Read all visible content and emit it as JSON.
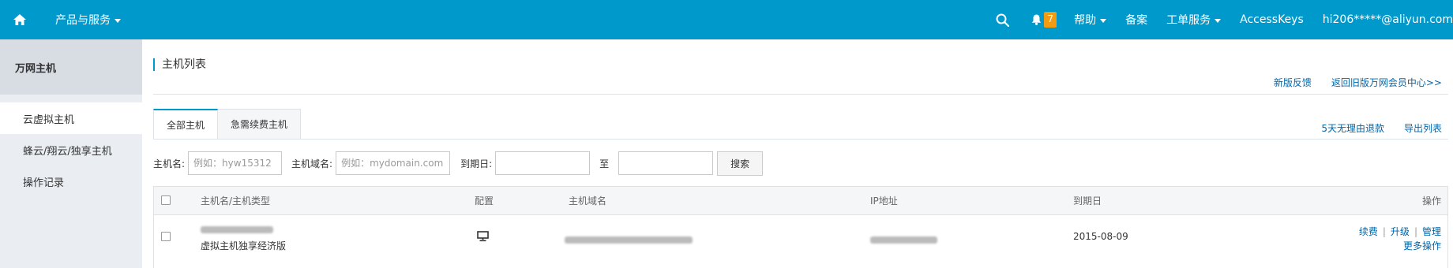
{
  "topbar": {
    "home_icon": "home-icon",
    "products_label": "产品与服务",
    "search_icon": "search-icon",
    "bell_icon": "bell-icon",
    "notification_count": "7",
    "help_label": "帮助",
    "beian_label": "备案",
    "ticket_label": "工单服务",
    "accesskeys_label": "AccessKeys",
    "user_label": "hi206*****@aliyun.com"
  },
  "sidebar": {
    "title": "万网主机",
    "items": [
      {
        "label": "云虚拟主机"
      },
      {
        "label": "蜂云/翔云/独享主机"
      },
      {
        "label": "操作记录"
      }
    ]
  },
  "main": {
    "title": "主机列表",
    "feedback_link": "新版反馈",
    "old_version_link": "返回旧版万网会员中心>>",
    "tabs": [
      {
        "label": "全部主机"
      },
      {
        "label": "急需续费主机"
      }
    ],
    "refund_link": "5天无理由退款",
    "export_link": "导出列表",
    "search": {
      "host_label": "主机名:",
      "host_placeholder": "例如：hyw15312",
      "domain_label": "主机域名:",
      "domain_placeholder": "例如：mydomain.com",
      "expire_label": "到期日:",
      "to_label": "至",
      "search_button": "搜索"
    },
    "table": {
      "headers": [
        "主机名/主机类型",
        "配置",
        "主机域名",
        "IP地址",
        "到期日",
        "操作"
      ],
      "rows": [
        {
          "host_type": "虚拟主机独享经济版",
          "config_icon": "monitor-icon",
          "expire_date": "2015-08-09",
          "ops": [
            "续费",
            "升级",
            "管理"
          ],
          "more_ops": "更多操作"
        }
      ]
    }
  }
}
